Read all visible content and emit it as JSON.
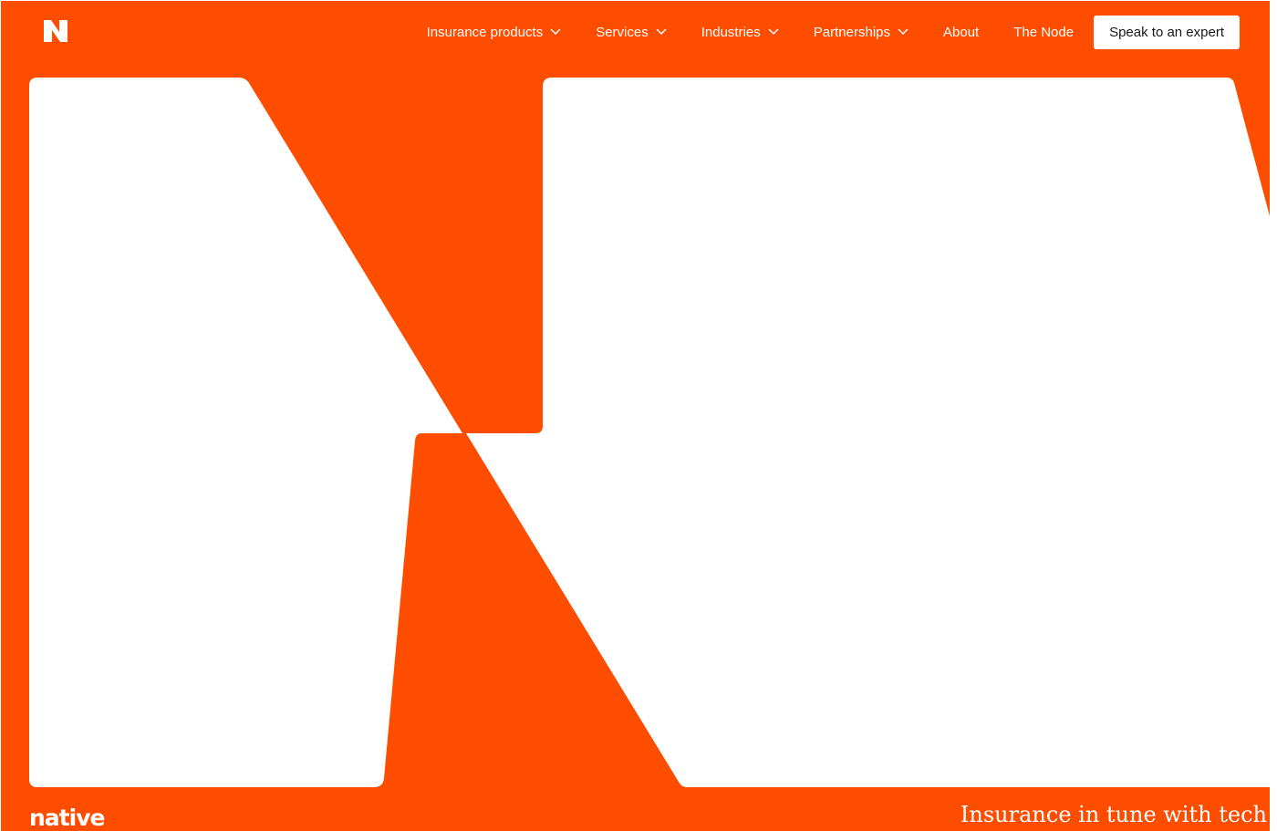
{
  "brand": {
    "logo_icon": "n-logo-icon",
    "wordmark": "native",
    "accent_color": "#ff4d00"
  },
  "nav": {
    "items": [
      {
        "label": "Insurance products",
        "has_dropdown": true
      },
      {
        "label": "Services",
        "has_dropdown": true
      },
      {
        "label": "Industries",
        "has_dropdown": true
      },
      {
        "label": "Partnerships",
        "has_dropdown": true
      },
      {
        "label": "About",
        "has_dropdown": false
      },
      {
        "label": "The Node",
        "has_dropdown": false
      }
    ],
    "cta_label": "Speak to an expert"
  },
  "hero": {
    "tagline": "Insurance in tune with tech"
  }
}
